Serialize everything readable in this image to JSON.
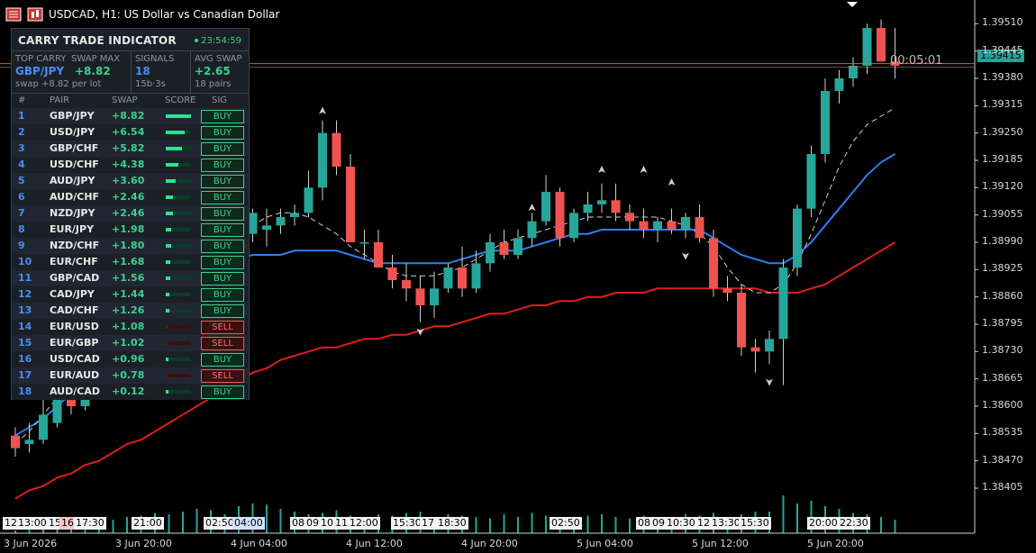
{
  "header": {
    "title": "USDCAD, H1:  US Dollar vs Canadian Dollar"
  },
  "panel": {
    "title": "CARRY TRADE INDICATOR",
    "clock": "23:54:59",
    "summary": {
      "top_carry_label": "TOP CARRY",
      "top_carry_pair": "GBP/JPY",
      "top_carry_value": "+8.82",
      "top_carry_sub": "swap +8.82 per lot",
      "swap_max_label": "SWAP MAX",
      "signals_label": "SIGNALS",
      "signals_value": "18",
      "signals_sub": "15b·3s",
      "avg_swap_label": "AVG SWAP",
      "avg_swap_value": "+2.65",
      "avg_swap_sub": "18 pairs"
    },
    "columns": {
      "num": "#",
      "pair": "PAIR",
      "swap": "SWAP",
      "score": "SCORE",
      "sig": "SIG"
    },
    "rows": [
      {
        "num": "1",
        "pair": "GBP/JPY",
        "swap": "+8.82",
        "score": 1.0,
        "sig": "BUY"
      },
      {
        "num": "2",
        "pair": "USD/JPY",
        "swap": "+6.54",
        "score": 0.74,
        "sig": "BUY"
      },
      {
        "num": "3",
        "pair": "GBP/CHF",
        "swap": "+5.82",
        "score": 0.66,
        "sig": "BUY"
      },
      {
        "num": "4",
        "pair": "USD/CHF",
        "swap": "+4.38",
        "score": 0.5,
        "sig": "BUY"
      },
      {
        "num": "5",
        "pair": "AUD/JPY",
        "swap": "+3.60",
        "score": 0.41,
        "sig": "BUY"
      },
      {
        "num": "6",
        "pair": "AUD/CHF",
        "swap": "+2.46",
        "score": 0.28,
        "sig": "BUY"
      },
      {
        "num": "7",
        "pair": "NZD/JPY",
        "swap": "+2.46",
        "score": 0.28,
        "sig": "BUY"
      },
      {
        "num": "8",
        "pair": "EUR/JPY",
        "swap": "+1.98",
        "score": 0.22,
        "sig": "BUY"
      },
      {
        "num": "9",
        "pair": "NZD/CHF",
        "swap": "+1.80",
        "score": 0.2,
        "sig": "BUY"
      },
      {
        "num": "10",
        "pair": "EUR/CHF",
        "swap": "+1.68",
        "score": 0.19,
        "sig": "BUY"
      },
      {
        "num": "11",
        "pair": "GBP/CAD",
        "swap": "+1.56",
        "score": 0.18,
        "sig": "BUY"
      },
      {
        "num": "12",
        "pair": "CAD/JPY",
        "swap": "+1.44",
        "score": 0.16,
        "sig": "BUY"
      },
      {
        "num": "13",
        "pair": "CAD/CHF",
        "swap": "+1.26",
        "score": 0.14,
        "sig": "BUY"
      },
      {
        "num": "14",
        "pair": "EUR/USD",
        "swap": "+1.08",
        "score": 0.0,
        "sig": "SELL"
      },
      {
        "num": "15",
        "pair": "EUR/GBP",
        "swap": "+1.02",
        "score": 0.0,
        "sig": "SELL"
      },
      {
        "num": "16",
        "pair": "USD/CAD",
        "swap": "+0.96",
        "score": 0.1,
        "sig": "BUY"
      },
      {
        "num": "17",
        "pair": "EUR/AUD",
        "swap": "+0.78",
        "score": 0.0,
        "sig": "SELL"
      },
      {
        "num": "18",
        "pair": "AUD/CAD",
        "swap": "+0.12",
        "score": 0.02,
        "sig": "BUY"
      }
    ]
  },
  "price": {
    "current": "1.39415",
    "countdown": "00:05:01",
    "axis": [
      "1.39510",
      "1.39445",
      "1.39380",
      "1.39315",
      "1.39250",
      "1.39185",
      "1.39120",
      "1.39055",
      "1.38990",
      "1.38925",
      "1.38860",
      "1.38795",
      "1.38730",
      "1.38665",
      "1.38600",
      "1.38535",
      "1.38470",
      "1.38405"
    ]
  },
  "time_axis": [
    "3 Jun 2026",
    "3 Jun 20:00",
    "4 Jun 04:00",
    "4 Jun 12:00",
    "4 Jun 20:00",
    "5 Jun 04:00",
    "5 Jun 12:00",
    "5 Jun 20:00"
  ],
  "session_tags": [
    {
      "text": "12",
      "type": "light"
    },
    {
      "text": "13:00",
      "type": "light"
    },
    {
      "text": "15",
      "type": "light"
    },
    {
      "text": "16",
      "type": "pink"
    },
    {
      "text": "17:30",
      "type": "light"
    },
    {
      "text": "21:00",
      "type": "light"
    },
    {
      "text": "02:50",
      "type": "light"
    },
    {
      "text": "04:00",
      "type": "blue"
    },
    {
      "text": "08",
      "type": "light"
    },
    {
      "text": "09",
      "type": "light"
    },
    {
      "text": "10",
      "type": "light"
    },
    {
      "text": "11",
      "type": "light"
    },
    {
      "text": "12:00",
      "type": "light"
    },
    {
      "text": "15:30",
      "type": "light"
    },
    {
      "text": "17",
      "type": "light"
    },
    {
      "text": "18:30",
      "type": "light"
    },
    {
      "text": "02:50",
      "type": "light"
    },
    {
      "text": "08",
      "type": "light"
    },
    {
      "text": "09",
      "type": "light"
    },
    {
      "text": "10:30",
      "type": "light"
    },
    {
      "text": "12",
      "type": "light"
    },
    {
      "text": "13:30",
      "type": "light"
    },
    {
      "text": "15:30",
      "type": "light"
    },
    {
      "text": "20:00",
      "type": "light"
    },
    {
      "text": "22:30",
      "type": "light"
    }
  ],
  "colors": {
    "bull": "#26a69a",
    "bear": "#ef5350",
    "ma_fast": "#2f7ff0",
    "ma_slow": "#e01d1d",
    "buy": "#3ecf8e",
    "sell": "#ff5050",
    "rank_blue": "#4a8df0"
  },
  "chart_data": {
    "type": "candlestick",
    "symbol": "USDCAD",
    "timeframe": "H1",
    "ylim": [
      1.3836,
      1.3953
    ],
    "candles": [
      [
        1.3853,
        1.3855,
        1.3848,
        1.385
      ],
      [
        1.3851,
        1.3856,
        1.3849,
        1.3852
      ],
      [
        1.3852,
        1.3862,
        1.3851,
        1.3858
      ],
      [
        1.3856,
        1.3868,
        1.3855,
        1.3866
      ],
      [
        1.3862,
        1.3866,
        1.3858,
        1.386
      ],
      [
        1.386,
        1.3869,
        1.3859,
        1.3868
      ],
      [
        1.3868,
        1.3874,
        1.3866,
        1.3872
      ],
      [
        1.3872,
        1.3879,
        1.387,
        1.3877
      ],
      [
        1.3877,
        1.3882,
        1.3875,
        1.388
      ],
      [
        1.388,
        1.3886,
        1.3878,
        1.3884
      ],
      [
        1.3884,
        1.3889,
        1.3882,
        1.3887
      ],
      [
        1.3887,
        1.3892,
        1.3885,
        1.389
      ],
      [
        1.389,
        1.3895,
        1.3888,
        1.3893
      ],
      [
        1.3893,
        1.3898,
        1.3891,
        1.3896
      ],
      [
        1.3896,
        1.39,
        1.3893,
        1.3898
      ],
      [
        1.3898,
        1.3902,
        1.3896,
        1.3899
      ],
      [
        1.3899,
        1.3903,
        1.3897,
        1.3901
      ],
      [
        1.3901,
        1.3907,
        1.3899,
        1.3906
      ],
      [
        1.3902,
        1.3907,
        1.3898,
        1.3903
      ],
      [
        1.3903,
        1.3907,
        1.3901,
        1.3905
      ],
      [
        1.3905,
        1.3908,
        1.3903,
        1.3906
      ],
      [
        1.3906,
        1.3916,
        1.3905,
        1.3912
      ],
      [
        1.3912,
        1.3928,
        1.3909,
        1.3925
      ],
      [
        1.3925,
        1.3928,
        1.3915,
        1.3917
      ],
      [
        1.3917,
        1.392,
        1.3899,
        1.3899
      ],
      [
        1.3899,
        1.3902,
        1.3895,
        1.3899
      ],
      [
        1.3899,
        1.3902,
        1.3893,
        1.3893
      ],
      [
        1.3893,
        1.3896,
        1.3888,
        1.389
      ],
      [
        1.389,
        1.3894,
        1.3885,
        1.3888
      ],
      [
        1.3888,
        1.3891,
        1.388,
        1.3884
      ],
      [
        1.3884,
        1.3892,
        1.3881,
        1.3888
      ],
      [
        1.3888,
        1.3894,
        1.3887,
        1.3893
      ],
      [
        1.3893,
        1.3898,
        1.3886,
        1.3888
      ],
      [
        1.3888,
        1.3897,
        1.3887,
        1.3894
      ],
      [
        1.3894,
        1.3901,
        1.3892,
        1.3899
      ],
      [
        1.3899,
        1.3902,
        1.3895,
        1.3896
      ],
      [
        1.3896,
        1.3902,
        1.3895,
        1.39
      ],
      [
        1.39,
        1.3906,
        1.3898,
        1.3904
      ],
      [
        1.3904,
        1.3915,
        1.3903,
        1.3911
      ],
      [
        1.3911,
        1.3912,
        1.3898,
        1.39
      ],
      [
        1.39,
        1.3907,
        1.3899,
        1.3906
      ],
      [
        1.3906,
        1.3911,
        1.3904,
        1.3908
      ],
      [
        1.3908,
        1.3913,
        1.3906,
        1.3909
      ],
      [
        1.3909,
        1.3913,
        1.3904,
        1.3906
      ],
      [
        1.3906,
        1.3908,
        1.3902,
        1.3904
      ],
      [
        1.3904,
        1.3907,
        1.39,
        1.3902
      ],
      [
        1.3902,
        1.3905,
        1.3899,
        1.3904
      ],
      [
        1.3904,
        1.3907,
        1.3901,
        1.3902
      ],
      [
        1.3902,
        1.3906,
        1.39,
        1.3905
      ],
      [
        1.3905,
        1.3908,
        1.3899,
        1.39
      ],
      [
        1.39,
        1.3902,
        1.3886,
        1.3888
      ],
      [
        1.3888,
        1.3891,
        1.3885,
        1.3887
      ],
      [
        1.3887,
        1.3889,
        1.3872,
        1.3874
      ],
      [
        1.3874,
        1.3876,
        1.3868,
        1.3873
      ],
      [
        1.3873,
        1.3878,
        1.387,
        1.3876
      ],
      [
        1.3876,
        1.3895,
        1.3865,
        1.3893
      ],
      [
        1.3893,
        1.3908,
        1.3891,
        1.3907
      ],
      [
        1.3907,
        1.3922,
        1.3905,
        1.392
      ],
      [
        1.392,
        1.3938,
        1.3918,
        1.3935
      ],
      [
        1.3935,
        1.394,
        1.3932,
        1.3938
      ],
      [
        1.3938,
        1.3943,
        1.3936,
        1.3941
      ],
      [
        1.3941,
        1.3951,
        1.3939,
        1.395
      ],
      [
        1.395,
        1.3952,
        1.3942,
        1.3942
      ],
      [
        1.3942,
        1.395,
        1.3938,
        1.3941
      ]
    ],
    "ma_fast": [
      1.3853,
      1.3855,
      1.3857,
      1.386,
      1.3863,
      1.3866,
      1.3869,
      1.3872,
      1.3875,
      1.3878,
      1.3881,
      1.3884,
      1.3886,
      1.3888,
      1.3891,
      1.3893,
      1.3895,
      1.3896,
      1.3896,
      1.3896,
      1.3897,
      1.3897,
      1.3897,
      1.3897,
      1.3896,
      1.3895,
      1.3894,
      1.3894,
      1.3894,
      1.3894,
      1.3894,
      1.3894,
      1.3895,
      1.3896,
      1.3897,
      1.3897,
      1.3897,
      1.3898,
      1.3899,
      1.39,
      1.3901,
      1.3901,
      1.3902,
      1.3902,
      1.3902,
      1.3902,
      1.3902,
      1.3902,
      1.3902,
      1.3902,
      1.39,
      1.3898,
      1.3896,
      1.3895,
      1.3894,
      1.3894,
      1.3896,
      1.3899,
      1.3903,
      1.3907,
      1.3911,
      1.3915,
      1.3918,
      1.392
    ],
    "ma_fast_dashed": [
      1.3851,
      1.3854,
      1.3858,
      1.3862,
      1.3865,
      1.3869,
      1.3873,
      1.3877,
      1.388,
      1.3884,
      1.3887,
      1.389,
      1.3893,
      1.3895,
      1.3897,
      1.3899,
      1.3901,
      1.3903,
      1.3905,
      1.3906,
      1.3906,
      1.3905,
      1.3903,
      1.3901,
      1.3898,
      1.3896,
      1.3894,
      1.3892,
      1.3891,
      1.3891,
      1.3891,
      1.3892,
      1.3893,
      1.3895,
      1.3897,
      1.3899,
      1.39,
      1.3901,
      1.3902,
      1.3903,
      1.3904,
      1.3905,
      1.3905,
      1.3905,
      1.3905,
      1.3905,
      1.3905,
      1.3904,
      1.3903,
      1.3901,
      1.3898,
      1.3893,
      1.3889,
      1.3887,
      1.3887,
      1.3889,
      1.3894,
      1.3901,
      1.3909,
      1.3917,
      1.3923,
      1.3927,
      1.3929,
      1.3931
    ],
    "ma_slow": [
      1.3838,
      1.384,
      1.3841,
      1.3843,
      1.3844,
      1.3846,
      1.3847,
      1.3849,
      1.3851,
      1.3852,
      1.3854,
      1.3856,
      1.3858,
      1.386,
      1.3862,
      1.3864,
      1.3866,
      1.3868,
      1.3869,
      1.3871,
      1.3872,
      1.3873,
      1.3874,
      1.3874,
      1.3875,
      1.3876,
      1.3876,
      1.3877,
      1.3877,
      1.3878,
      1.3879,
      1.3879,
      1.388,
      1.3881,
      1.3882,
      1.3882,
      1.3883,
      1.3884,
      1.3884,
      1.3885,
      1.3885,
      1.3886,
      1.3886,
      1.3887,
      1.3887,
      1.3887,
      1.3888,
      1.3888,
      1.3888,
      1.3888,
      1.3888,
      1.3888,
      1.3888,
      1.3888,
      1.3887,
      1.3887,
      1.3887,
      1.3888,
      1.3889,
      1.3891,
      1.3893,
      1.3895,
      1.3897,
      1.3899
    ],
    "volume": [
      2,
      3,
      5,
      6,
      7,
      8,
      9,
      10,
      12,
      13,
      15,
      14,
      16,
      18,
      17,
      14,
      20,
      22,
      21,
      18,
      16,
      14,
      15,
      17,
      13,
      12,
      14,
      13,
      15,
      16,
      12,
      14,
      13,
      12,
      11,
      14,
      12,
      15,
      13,
      12,
      12,
      13,
      14,
      12,
      11,
      13,
      12,
      11,
      14,
      13,
      15,
      12,
      14,
      16,
      16,
      28,
      22,
      24,
      20,
      18,
      15,
      14,
      12,
      10
    ],
    "arrows_up": [
      [
        22,
        1.3928
      ],
      [
        37,
        1.3905
      ],
      [
        42,
        1.3914
      ],
      [
        45,
        1.3914
      ],
      [
        47,
        1.3911
      ]
    ],
    "arrows_down": [
      [
        29,
        1.388
      ],
      [
        48,
        1.3898
      ],
      [
        54,
        1.3868
      ]
    ]
  }
}
